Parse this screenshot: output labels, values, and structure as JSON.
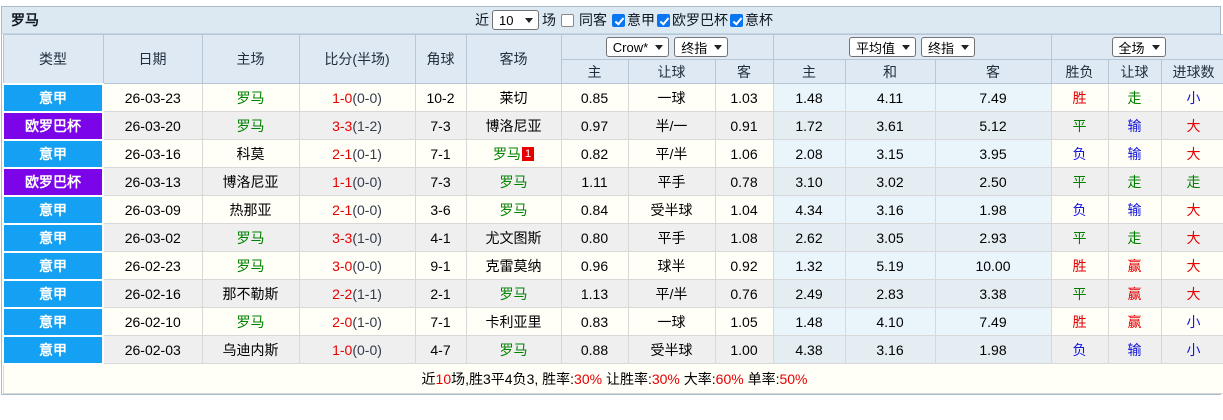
{
  "title": "罗马",
  "topbar": {
    "near_label": "近",
    "games_count": "10",
    "games_label": "场",
    "same_venue": {
      "label": "同客",
      "checked": false
    },
    "filters": [
      {
        "label": "意甲",
        "checked": true
      },
      {
        "label": "欧罗巴杯",
        "checked": true
      },
      {
        "label": "意杯",
        "checked": true
      }
    ]
  },
  "header": {
    "static_cols": [
      "类型",
      "日期",
      "主场",
      "比分(半场)",
      "角球",
      "客场"
    ],
    "asian_group": {
      "selects": [
        "Crow*",
        "终指"
      ],
      "cols": [
        "主",
        "让球",
        "客"
      ]
    },
    "euro_group": {
      "selects": [
        "平均值",
        "终指"
      ],
      "cols": [
        "主",
        "和",
        "客"
      ]
    },
    "result_group": {
      "selects": [
        "全场"
      ],
      "cols": [
        "胜负",
        "让球",
        "进球数"
      ]
    }
  },
  "colors": {
    "serie_a": "#14a1f4",
    "europa_league": "#7c04e8",
    "roma_green": "#008000",
    "score_red": "#e60000",
    "titlebar_bg": "#dce8f2",
    "header_bg": "#dfe9f3",
    "row_even_bg": "#efefef",
    "avg_col_bg": "#e9f5fb"
  },
  "rows": [
    {
      "league": {
        "label": "意甲",
        "color": "#14a1f4"
      },
      "date": "26-03-23",
      "home": {
        "name": "罗马",
        "green": true
      },
      "score": {
        "ft": "1-0",
        "ht": "(0-0)"
      },
      "corner": "10-2",
      "away": {
        "name": "莱切",
        "green": false
      },
      "asian": [
        "0.85",
        "一球",
        "1.03"
      ],
      "euro": [
        "1.48",
        "4.11",
        "7.49"
      ],
      "results": [
        {
          "t": "胜",
          "c": "red"
        },
        {
          "t": "走",
          "c": "green"
        },
        {
          "t": "小",
          "c": "blue"
        }
      ]
    },
    {
      "league": {
        "label": "欧罗巴杯",
        "color": "#7c04e8"
      },
      "date": "26-03-20",
      "home": {
        "name": "罗马",
        "green": true
      },
      "score": {
        "ft": "3-3",
        "ht": "(1-2)"
      },
      "corner": "7-3",
      "away": {
        "name": "博洛尼亚",
        "green": false
      },
      "asian": [
        "0.97",
        "半/一",
        "0.91"
      ],
      "euro": [
        "1.72",
        "3.61",
        "5.12"
      ],
      "results": [
        {
          "t": "平",
          "c": "green"
        },
        {
          "t": "输",
          "c": "blue"
        },
        {
          "t": "大",
          "c": "red"
        }
      ]
    },
    {
      "league": {
        "label": "意甲",
        "color": "#14a1f4"
      },
      "date": "26-03-16",
      "home": {
        "name": "科莫",
        "green": false
      },
      "score": {
        "ft": "2-1",
        "ht": "(0-1)"
      },
      "corner": "7-1",
      "away": {
        "name": "罗马",
        "green": true,
        "badge": "1"
      },
      "asian": [
        "0.82",
        "平/半",
        "1.06"
      ],
      "euro": [
        "2.08",
        "3.15",
        "3.95"
      ],
      "results": [
        {
          "t": "负",
          "c": "blue"
        },
        {
          "t": "输",
          "c": "blue"
        },
        {
          "t": "大",
          "c": "red"
        }
      ]
    },
    {
      "league": {
        "label": "欧罗巴杯",
        "color": "#7c04e8"
      },
      "date": "26-03-13",
      "home": {
        "name": "博洛尼亚",
        "green": false
      },
      "score": {
        "ft": "1-1",
        "ht": "(0-0)"
      },
      "corner": "7-3",
      "away": {
        "name": "罗马",
        "green": true
      },
      "asian": [
        "1.11",
        "平手",
        "0.78"
      ],
      "euro": [
        "3.10",
        "3.02",
        "2.50"
      ],
      "results": [
        {
          "t": "平",
          "c": "green"
        },
        {
          "t": "走",
          "c": "green"
        },
        {
          "t": "走",
          "c": "green"
        }
      ]
    },
    {
      "league": {
        "label": "意甲",
        "color": "#14a1f4"
      },
      "date": "26-03-09",
      "home": {
        "name": "热那亚",
        "green": false
      },
      "score": {
        "ft": "2-1",
        "ht": "(0-0)"
      },
      "corner": "3-6",
      "away": {
        "name": "罗马",
        "green": true
      },
      "asian": [
        "0.84",
        "受半球",
        "1.04"
      ],
      "euro": [
        "4.34",
        "3.16",
        "1.98"
      ],
      "results": [
        {
          "t": "负",
          "c": "blue"
        },
        {
          "t": "输",
          "c": "blue"
        },
        {
          "t": "大",
          "c": "red"
        }
      ]
    },
    {
      "league": {
        "label": "意甲",
        "color": "#14a1f4"
      },
      "date": "26-03-02",
      "home": {
        "name": "罗马",
        "green": true
      },
      "score": {
        "ft": "3-3",
        "ht": "(1-0)"
      },
      "corner": "4-1",
      "away": {
        "name": "尤文图斯",
        "green": false
      },
      "asian": [
        "0.80",
        "平手",
        "1.08"
      ],
      "euro": [
        "2.62",
        "3.05",
        "2.93"
      ],
      "results": [
        {
          "t": "平",
          "c": "green"
        },
        {
          "t": "走",
          "c": "green"
        },
        {
          "t": "大",
          "c": "red"
        }
      ]
    },
    {
      "league": {
        "label": "意甲",
        "color": "#14a1f4"
      },
      "date": "26-02-23",
      "home": {
        "name": "罗马",
        "green": true
      },
      "score": {
        "ft": "3-0",
        "ht": "(0-0)"
      },
      "corner": "9-1",
      "away": {
        "name": "克雷莫纳",
        "green": false
      },
      "asian": [
        "0.96",
        "球半",
        "0.92"
      ],
      "euro": [
        "1.32",
        "5.19",
        "10.00"
      ],
      "results": [
        {
          "t": "胜",
          "c": "red"
        },
        {
          "t": "赢",
          "c": "red"
        },
        {
          "t": "大",
          "c": "red"
        }
      ]
    },
    {
      "league": {
        "label": "意甲",
        "color": "#14a1f4"
      },
      "date": "26-02-16",
      "home": {
        "name": "那不勒斯",
        "green": false
      },
      "score": {
        "ft": "2-2",
        "ht": "(1-1)"
      },
      "corner": "2-1",
      "away": {
        "name": "罗马",
        "green": true
      },
      "asian": [
        "1.13",
        "平/半",
        "0.76"
      ],
      "euro": [
        "2.49",
        "2.83",
        "3.38"
      ],
      "results": [
        {
          "t": "平",
          "c": "green"
        },
        {
          "t": "赢",
          "c": "red"
        },
        {
          "t": "大",
          "c": "red"
        }
      ]
    },
    {
      "league": {
        "label": "意甲",
        "color": "#14a1f4"
      },
      "date": "26-02-10",
      "home": {
        "name": "罗马",
        "green": true
      },
      "score": {
        "ft": "2-0",
        "ht": "(1-0)"
      },
      "corner": "7-1",
      "away": {
        "name": "卡利亚里",
        "green": false
      },
      "asian": [
        "0.83",
        "一球",
        "1.05"
      ],
      "euro": [
        "1.48",
        "4.10",
        "7.49"
      ],
      "results": [
        {
          "t": "胜",
          "c": "red"
        },
        {
          "t": "赢",
          "c": "red"
        },
        {
          "t": "小",
          "c": "blue"
        }
      ]
    },
    {
      "league": {
        "label": "意甲",
        "color": "#14a1f4"
      },
      "date": "26-02-03",
      "home": {
        "name": "乌迪内斯",
        "green": false
      },
      "score": {
        "ft": "1-0",
        "ht": "(0-0)"
      },
      "corner": "4-7",
      "away": {
        "name": "罗马",
        "green": true
      },
      "asian": [
        "0.88",
        "受半球",
        "1.00"
      ],
      "euro": [
        "4.38",
        "3.16",
        "1.98"
      ],
      "results": [
        {
          "t": "负",
          "c": "blue"
        },
        {
          "t": "输",
          "c": "blue"
        },
        {
          "t": "小",
          "c": "blue"
        }
      ]
    }
  ],
  "footer": {
    "segments": [
      {
        "t": "近",
        "red": false
      },
      {
        "t": "10",
        "red": true
      },
      {
        "t": "场,胜3平4负3, 胜率:",
        "red": false
      },
      {
        "t": "30%",
        "red": true
      },
      {
        "t": " 让胜率:",
        "red": false
      },
      {
        "t": "30%",
        "red": true
      },
      {
        "t": " 大率:",
        "red": false
      },
      {
        "t": "60%",
        "red": true
      },
      {
        "t": " 单率:",
        "red": false
      },
      {
        "t": "50%",
        "red": true
      }
    ]
  }
}
